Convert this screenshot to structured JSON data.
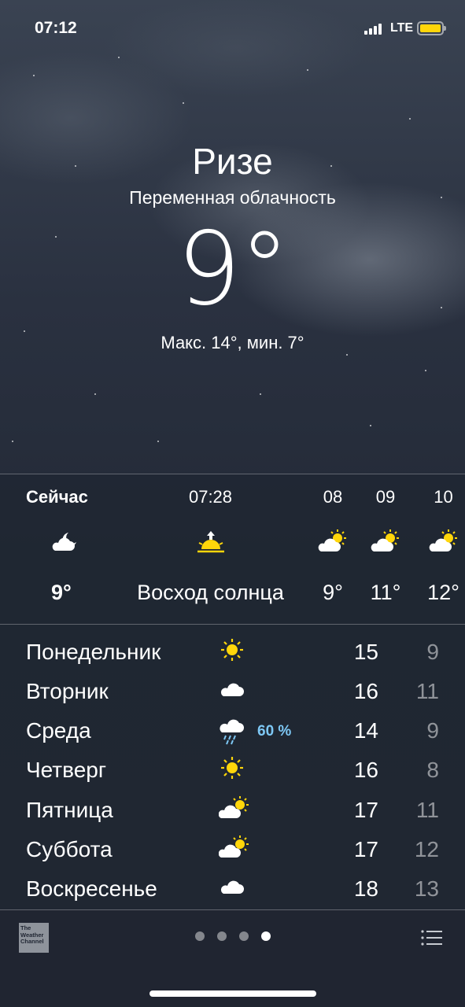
{
  "status_bar": {
    "time": "07:12",
    "network": "LTE"
  },
  "location": {
    "city": "Ризе",
    "condition": "Переменная облачность",
    "temperature": "9°",
    "high_low": "Макс. 14°, мин. 7°"
  },
  "hourly": [
    {
      "label": "Сейчас",
      "icon": "partly-cloudy-night-icon",
      "temp": "9°"
    },
    {
      "label": "07:28",
      "icon": "sunrise-icon",
      "temp": "Восход солнца"
    },
    {
      "label": "08",
      "icon": "partly-sunny-icon",
      "temp": "9°"
    },
    {
      "label": "09",
      "icon": "partly-sunny-icon",
      "temp": "11°"
    },
    {
      "label": "10",
      "icon": "partly-sunny-icon",
      "temp": "12°"
    }
  ],
  "daily": [
    {
      "day": "Понедельник",
      "icon": "sun-icon",
      "precip": "",
      "high": "15",
      "low": "9"
    },
    {
      "day": "Вторник",
      "icon": "cloud-icon",
      "precip": "",
      "high": "16",
      "low": "11"
    },
    {
      "day": "Среда",
      "icon": "rain-icon",
      "precip": "60 %",
      "high": "14",
      "low": "9"
    },
    {
      "day": "Четверг",
      "icon": "sun-icon",
      "precip": "",
      "high": "16",
      "low": "8"
    },
    {
      "day": "Пятница",
      "icon": "partly-sunny-icon",
      "precip": "",
      "high": "17",
      "low": "11"
    },
    {
      "day": "Суббота",
      "icon": "partly-sunny-icon",
      "precip": "",
      "high": "17",
      "low": "12"
    },
    {
      "day": "Воскресенье",
      "icon": "cloud-icon",
      "precip": "",
      "high": "18",
      "low": "13"
    }
  ],
  "footer": {
    "logo_text": "The Weather Channel",
    "page_count": 4,
    "active_page": 4
  },
  "colors": {
    "sun": "#ffd60a",
    "precip": "#7ec8f5",
    "battery": "#ffd60a"
  }
}
